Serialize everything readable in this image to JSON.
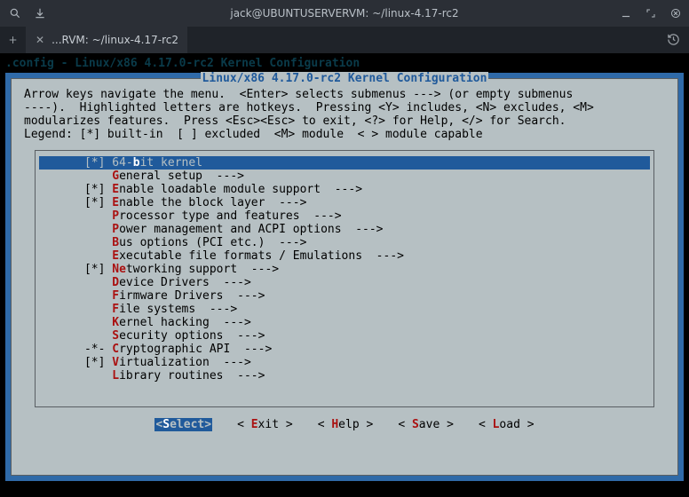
{
  "window": {
    "title": "jack@UBUNTUSERVERVM: ~/linux-4.17-rc2",
    "tab_label": "...RVM: ~/linux-4.17-rc2"
  },
  "shadow_line": ".config - Linux/x86 4.17.0-rc2 Kernel Configuration",
  "dialog": {
    "title": " Linux/x86 4.17.0-rc2 Kernel Configuration ",
    "help1": "Arrow keys navigate the menu.  <Enter> selects submenus ---> (or empty submenus",
    "help2": "----).  Highlighted letters are hotkeys.  Pressing <Y> includes, <N> excludes, <M>",
    "help3": "modularizes features.  Press <Esc><Esc> to exit, <?> for Help, </> for Search.",
    "help4": "Legend: [*] built-in  [ ] excluded  <M> module  < > module capable"
  },
  "menu": [
    {
      "mark": "[*]",
      "hk": "b",
      "pre": "64-",
      "post": "it kernel",
      "tail": "",
      "selected": true
    },
    {
      "mark": "",
      "hk": "G",
      "pre": "",
      "post": "eneral setup  --->",
      "tail": ""
    },
    {
      "mark": "[*]",
      "hk": "E",
      "pre": "",
      "post": "nable loadable module support  --->",
      "tail": ""
    },
    {
      "mark": "[*]",
      "hk": "E",
      "pre": "",
      "post": "nable the block layer  --->",
      "tail": ""
    },
    {
      "mark": "",
      "hk": "P",
      "pre": "",
      "post": "rocessor type and features  --->",
      "tail": ""
    },
    {
      "mark": "",
      "hk": "P",
      "pre": "",
      "post": "ower management and ACPI options  --->",
      "tail": ""
    },
    {
      "mark": "",
      "hk": "B",
      "pre": "",
      "post": "us options (PCI etc.)  --->",
      "tail": ""
    },
    {
      "mark": "",
      "hk": "E",
      "pre": "",
      "post": "xecutable file formats / Emulations  --->",
      "tail": ""
    },
    {
      "mark": "[*]",
      "hk": "N",
      "pre": "",
      "post": "",
      "hk2": "e",
      "post2": "tworking support  --->",
      "tail": ""
    },
    {
      "mark": "",
      "hk": "D",
      "pre": "",
      "post": "evice Drivers  --->",
      "tail": ""
    },
    {
      "mark": "",
      "hk": "F",
      "pre": "",
      "post": "irmware Drivers  --->",
      "tail": ""
    },
    {
      "mark": "",
      "hk": "F",
      "pre": "",
      "post": "ile systems  --->",
      "tail": ""
    },
    {
      "mark": "",
      "hk": "K",
      "pre": "",
      "post": "ernel hacking  --->",
      "tail": ""
    },
    {
      "mark": "",
      "hk": "S",
      "pre": "",
      "post": "ecurity options  --->",
      "tail": ""
    },
    {
      "mark": "-*-",
      "hk": "C",
      "pre": "",
      "post": "ryptographic API  --->",
      "tail": ""
    },
    {
      "mark": "[*]",
      "hk": "V",
      "pre": "",
      "post": "irtualization  --->",
      "tail": ""
    },
    {
      "mark": "",
      "hk": "L",
      "pre": "",
      "post": "ibrary routines  --->",
      "tail": ""
    }
  ],
  "buttons": [
    {
      "hk": "S",
      "rest": "elect",
      "selected": true
    },
    {
      "hk": "E",
      "rest": "xit"
    },
    {
      "hk": "H",
      "rest": "elp"
    },
    {
      "hk": "S",
      "rest": "ave"
    },
    {
      "hk": "L",
      "rest": "oad"
    }
  ]
}
